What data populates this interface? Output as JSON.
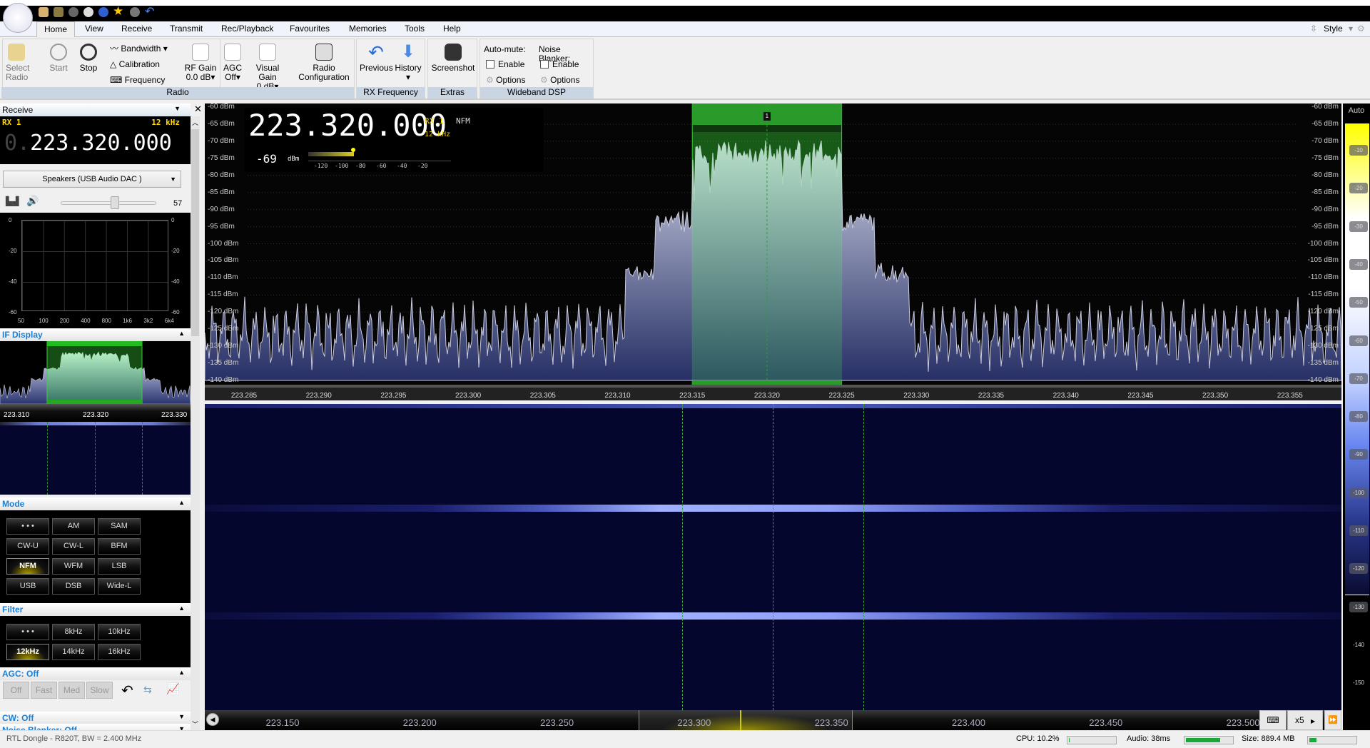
{
  "toolbar": {
    "quick_access_icons": [
      "home-icon",
      "folder-icon",
      "play-icon",
      "stop-icon",
      "add-icon",
      "favourite-star-icon",
      "camera-icon",
      "undo-icon",
      "dropdown-icon"
    ]
  },
  "tabs": [
    "Home",
    "View",
    "Receive",
    "Transmit",
    "Rec/Playback",
    "Favourites",
    "Memories",
    "Tools",
    "Help"
  ],
  "style_label": "Style",
  "ribbon": {
    "radio": {
      "label": "Radio",
      "select_radio": "Select Radio",
      "start": "Start",
      "stop": "Stop",
      "bandwidth": "Bandwidth",
      "calibration": "Calibration",
      "frequency": "Frequency",
      "rf_gain": "RF Gain",
      "rf_gain_value": "0.0 dB",
      "agc": "AGC",
      "agc_value": "Off",
      "visual_gain": "Visual Gain",
      "visual_gain_value": "0 dB",
      "radio_configuration": "Radio Configuration"
    },
    "rx_frequency": {
      "label": "RX Frequency",
      "previous": "Previous",
      "history": "History"
    },
    "extras": {
      "label": "Extras",
      "screenshot": "Screenshot"
    },
    "wideband_dsp": {
      "label": "Wideband DSP",
      "auto_mute": "Auto-mute:",
      "noise_blanker": "Noise Blanker:",
      "enable": "Enable",
      "options": "Options"
    }
  },
  "receive": {
    "title": "Receive",
    "rx": "RX 1",
    "bandwidth": "12 kHz",
    "freq_prefix": "0.",
    "frequency": "223.320.000",
    "audio_device": "Speakers (USB Audio DAC   )",
    "volume": "57",
    "volume_level": 57,
    "audio_y_labels": [
      "0",
      "-20",
      "-40",
      "-60"
    ],
    "audio_x_labels": [
      "50",
      "100",
      "200",
      "400",
      "800",
      "1k6",
      "3k2",
      "6k4"
    ]
  },
  "if_display": {
    "title": "IF Display",
    "freq_labels": [
      "223.310",
      "223.320",
      "223.330"
    ]
  },
  "mode": {
    "title": "Mode",
    "buttons": [
      "• • •",
      "AM",
      "SAM",
      "CW-U",
      "CW-L",
      "BFM",
      "NFM",
      "WFM",
      "LSB",
      "USB",
      "DSB",
      "Wide-L"
    ],
    "selected": "NFM"
  },
  "filter": {
    "title": "Filter",
    "buttons": [
      "• • •",
      "8kHz",
      "10kHz",
      "12kHz",
      "14kHz",
      "16kHz"
    ],
    "selected": "12kHz"
  },
  "agc": {
    "title": "AGC: Off",
    "buttons": [
      "Off",
      "Fast",
      "Med",
      "Slow"
    ]
  },
  "cw": {
    "title": "CW: Off"
  },
  "noise_blanker": {
    "title": "Noise Blanker: Off"
  },
  "spectrum": {
    "frequency": "223.320.000",
    "rx": "RX 1",
    "mode": "NFM",
    "bandwidth": "12 kHz",
    "signal": "-69",
    "signal_unit": "dBm",
    "meter_labels": [
      "-120",
      "-100",
      "-80",
      "-60",
      "-40",
      "-20"
    ],
    "marker": "1",
    "db_labels": [
      "-60 dBm",
      "-65 dBm",
      "-70 dBm",
      "-75 dBm",
      "-80 dBm",
      "-85 dBm",
      "-90 dBm",
      "-95 dBm",
      "-100 dBm",
      "-105 dBm",
      "-110 dBm",
      "-115 dBm",
      "-120 dBm",
      "-125 dBm",
      "-130 dBm",
      "-135 dBm",
      "-140 dBm"
    ],
    "freq_labels": [
      "223.285",
      "223.290",
      "223.295",
      "223.300",
      "223.305",
      "223.310",
      "223.315",
      "223.320",
      "223.325",
      "223.330",
      "223.335",
      "223.340",
      "223.345",
      "223.350",
      "223.355"
    ],
    "passband_color": "#2ecc2e",
    "trace_color": "#9aa8d8"
  },
  "waterfall": {
    "axis_labels": [
      "223.150",
      "223.200",
      "223.250",
      "223.300",
      "223.350",
      "223.400",
      "223.450",
      "223.500"
    ],
    "zoom": "x5"
  },
  "colorbar": {
    "auto": "Auto",
    "labels": [
      "-10",
      "-20",
      "-30",
      "-40",
      "-50",
      "-60",
      "-70",
      "-80",
      "-90",
      "-100",
      "-110",
      "-120",
      "-130",
      "-140",
      "-150"
    ]
  },
  "status": {
    "device": "RTL Dongle - R820T, BW = 2.400 MHz",
    "cpu": "CPU: 10.2%",
    "cpu_level": 2,
    "audio": "Audio: 38ms",
    "audio_level": 75,
    "size": "Size: 889.4 MB",
    "size_level": 15
  }
}
